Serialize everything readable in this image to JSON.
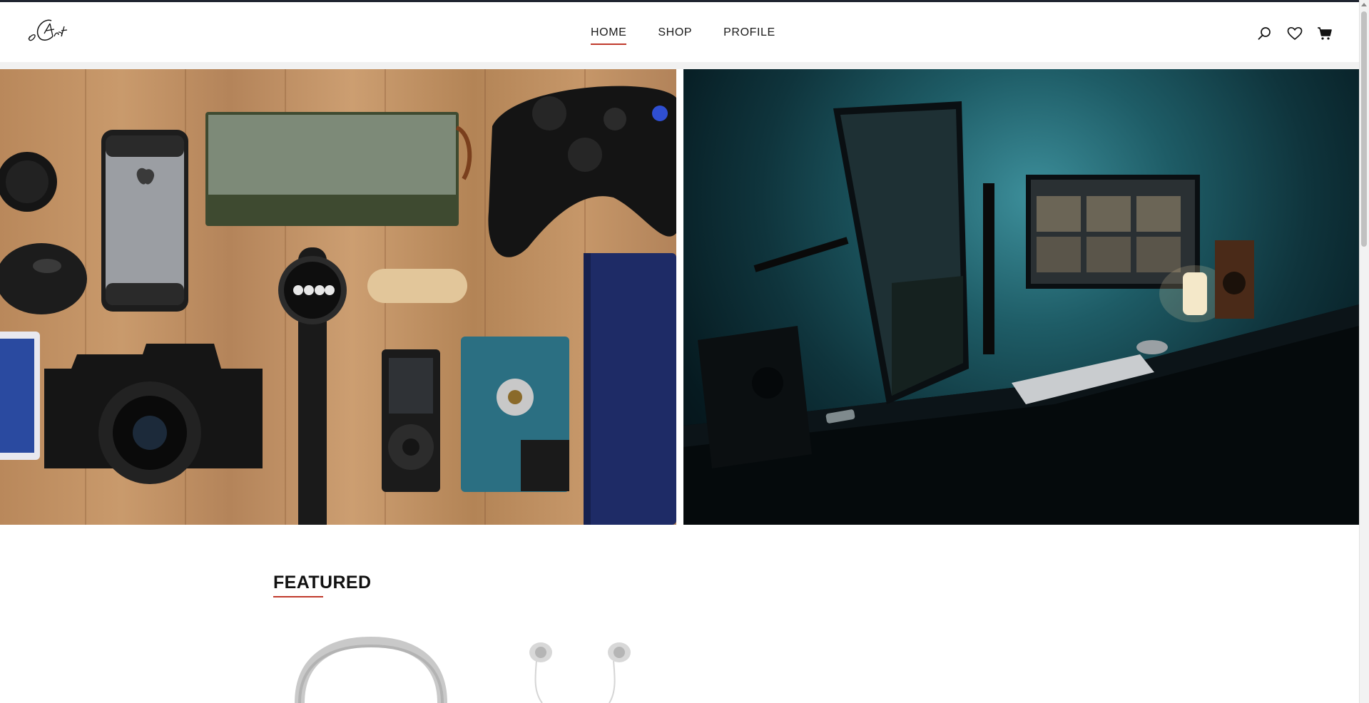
{
  "brand": {
    "logo_text": "eCart"
  },
  "nav": {
    "items": [
      {
        "label": "HOME",
        "active": true
      },
      {
        "label": "SHOP",
        "active": false
      },
      {
        "label": "PROFILE",
        "active": false
      }
    ]
  },
  "header_icons": [
    "search-icon",
    "heart-icon",
    "cart-icon"
  ],
  "hero": {
    "left_image": "flat-lay of gadgets on wooden table (phone, speaker, game controller, watch, camera, mp3 player, hard drive, notebook)",
    "right_image": "desk setup with monitors, speakers and keyboard lit by teal light"
  },
  "featured": {
    "title": "FEATURED",
    "products": [
      "headphones",
      "earphones"
    ]
  },
  "colors": {
    "accent": "#c0392b",
    "text": "#1a1a1a",
    "topbar": "#1f2430"
  }
}
